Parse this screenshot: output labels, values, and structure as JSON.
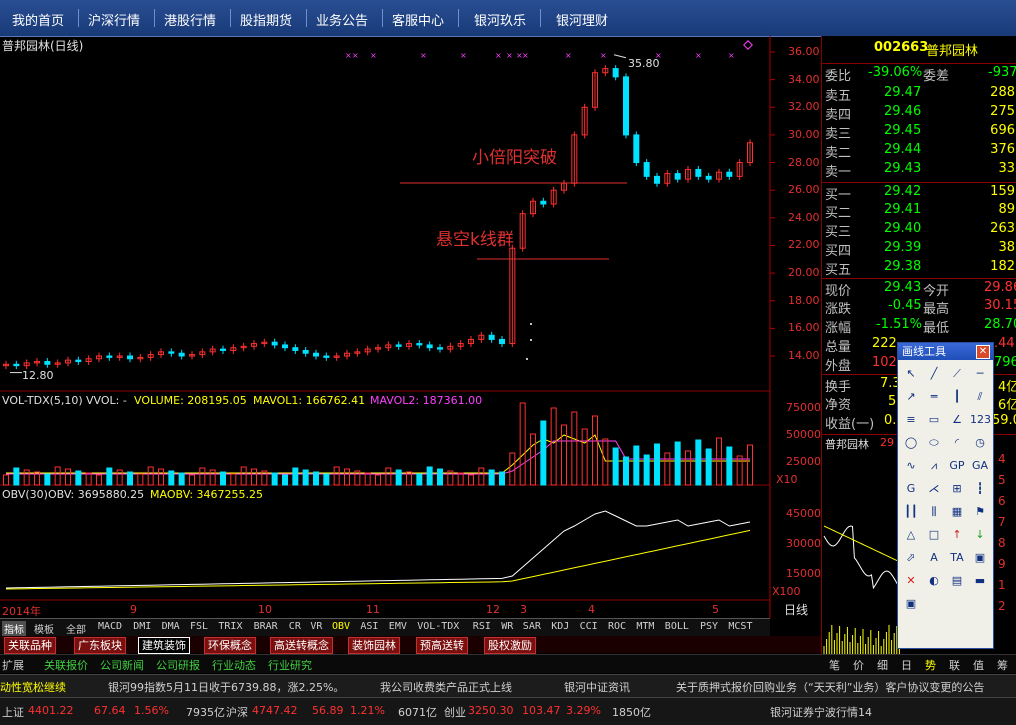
{
  "menu": [
    "我的首页",
    "沪深行情",
    "港股行情",
    "股指期货",
    "业务公告",
    "客服中心",
    "银河玖乐",
    "银河理财"
  ],
  "chart": {
    "title": "普邦园林(日线)",
    "price_ticks": [
      "36.00",
      "34.00",
      "32.00",
      "30.00",
      "28.00",
      "26.00",
      "24.00",
      "22.00",
      "20.00",
      "18.00",
      "16.00",
      "14.00"
    ],
    "high_label": "35.80",
    "low_label": "12.80",
    "annotation_top": "小倍阳突破",
    "annotation_bottom": "悬空k线群",
    "volume_header": {
      "name": "VOL-TDX(5,10)",
      "vvol": "VVOL: -",
      "volume": "VOLUME: 208195.05",
      "mavol1": "MAVOL1: 166762.41",
      "mavol2": "MAVOL2: 187361.00"
    },
    "volume_ticks": [
      "75000",
      "50000",
      "25000"
    ],
    "volume_unit": "X10",
    "obv_header": {
      "name": "OBV(30)",
      "obv": "OBV: 3695880.25",
      "maobv": "MAOBV: 3467255.25"
    },
    "obv_ticks": [
      "45000",
      "30000",
      "15000"
    ],
    "obv_unit": "X100",
    "period_label": "日线",
    "time_axis": [
      "2014年",
      "9",
      "10",
      "11",
      "12",
      "3",
      "4",
      "5"
    ]
  },
  "chart_data": {
    "type": "candlestick",
    "title": "普邦园林(日线)",
    "ylim": [
      12,
      37
    ],
    "high": 35.8,
    "low": 12.8,
    "close": [
      13.4,
      13.3,
      13.5,
      13.6,
      13.4,
      13.5,
      13.7,
      13.6,
      13.8,
      14.0,
      13.9,
      14.0,
      13.8,
      13.9,
      14.1,
      14.3,
      14.2,
      14.0,
      14.1,
      14.3,
      14.5,
      14.4,
      14.6,
      14.7,
      14.9,
      15.0,
      14.8,
      14.6,
      14.4,
      14.2,
      14.0,
      13.9,
      14.0,
      14.2,
      14.3,
      14.5,
      14.6,
      14.8,
      14.7,
      14.9,
      14.8,
      14.6,
      14.5,
      14.7,
      14.9,
      15.2,
      15.5,
      15.2,
      14.9,
      21.8,
      24.3,
      25.2,
      25.0,
      26.0,
      26.5,
      30.0,
      32.0,
      34.5,
      34.8,
      34.2,
      30.0,
      28.0,
      27.0,
      26.5,
      27.2,
      26.8,
      27.5,
      27.0,
      26.8,
      27.3,
      27.0,
      28.0,
      29.43
    ]
  },
  "quote": {
    "code": "002663",
    "name": "普邦园林",
    "weibi_label": "委比",
    "weibi": "-39.06%",
    "weicha_label": "委差",
    "weicha": "-937",
    "sells": [
      {
        "label": "卖五",
        "price": "29.47",
        "vol": "288"
      },
      {
        "label": "卖四",
        "price": "29.46",
        "vol": "275"
      },
      {
        "label": "卖三",
        "price": "29.45",
        "vol": "696"
      },
      {
        "label": "卖二",
        "price": "29.44",
        "vol": "376"
      },
      {
        "label": "卖一",
        "price": "29.43",
        "vol": "33"
      }
    ],
    "buys": [
      {
        "label": "买一",
        "price": "29.42",
        "vol": "159"
      },
      {
        "label": "买二",
        "price": "29.41",
        "vol": "89"
      },
      {
        "label": "买三",
        "price": "29.40",
        "vol": "263"
      },
      {
        "label": "买四",
        "price": "29.39",
        "vol": "38"
      },
      {
        "label": "买五",
        "price": "29.38",
        "vol": "182"
      }
    ],
    "xianjia_label": "现价",
    "xianjia": "29.43",
    "jinkai_label": "今开",
    "jinkai": "29.86",
    "zhangdie_label": "涨跌",
    "zhangdie": "-0.45",
    "zuigao_label": "最高",
    "zuigao": "30.15",
    "zhangfu_label": "涨幅",
    "zhangfu": "-1.51%",
    "zuidi_label": "最低",
    "zuidi": "28.70",
    "zongliang_label": "总量",
    "zongliang": "222",
    "zongliang_right": ".44",
    "waipan_label": "外盘",
    "waipan": "102",
    "waipan_right": "796",
    "huanshou_label": "换手",
    "huanshou": "7.3",
    "huanshou_right": "4亿",
    "jingzi_label": "净资",
    "jingzi": "5",
    "jingzi_right": "6亿",
    "shouyi_label": "收益(一)",
    "shouyi": "0.",
    "shouyi_right": "59.0",
    "mini_title": "普邦园林",
    "mini_num": "29"
  },
  "tool": {
    "title": "画线工具",
    "icons": [
      "cursor-icon",
      "line-icon",
      "ray-icon",
      "segment-icon",
      "arrow-line-icon",
      "hline-icon",
      "vline-icon",
      "channel-icon",
      "fib-icon",
      "rect-icon",
      "angle-icon",
      "text-icon",
      "circle-icon",
      "ellipse-icon",
      "arc-icon",
      "clock-icon",
      "wave-icon",
      "zigzag-icon",
      "gp-icon",
      "ga-icon",
      "g-icon",
      "fan-icon",
      "gann-icon",
      "period-icon",
      "bars-icon",
      "comb-icon",
      "grid-icon",
      "flag-icon",
      "triangle-icon",
      "square-icon",
      "up-arrow-icon",
      "down-arrow-icon",
      "trend-icon",
      "letter-a-icon",
      "text-a-icon",
      "box-icon",
      "delete-icon",
      "hide-icon",
      "doc-icon",
      "ruler-icon",
      "panel-icon"
    ],
    "labels": {
      "gp": "GP",
      "ga": "GA",
      "g": "G",
      "a": "A",
      "ta": "TA",
      "num": "123"
    }
  },
  "right_edge_nums": [
    "4",
    "5",
    "6",
    "7",
    "8",
    "9",
    "1",
    "2"
  ],
  "tabs1": [
    "指标",
    "模板",
    "全部",
    "MACD",
    "DMI",
    "DMA",
    "FSL",
    "TRIX",
    "BRAR",
    "CR",
    "VR",
    "OBV",
    "ASI",
    "EMV",
    "VOL-TDX",
    "RSI",
    "WR",
    "SAR",
    "KDJ",
    "CCI",
    "ROC",
    "MTM",
    "BOLL",
    "PSY",
    "MCST"
  ],
  "tabs2": [
    "关联品种",
    "广东板块",
    "建筑装饰",
    "环保概念",
    "高送转概念",
    "装饰园林",
    "预高送转",
    "股权激励"
  ],
  "tabs3": [
    "扩展",
    "关联报价",
    "公司新闻",
    "公司研报",
    "行业动态",
    "行业研究"
  ],
  "tabs4": [
    "笔",
    "价",
    "细",
    "日",
    "势",
    "联",
    "值",
    "筹"
  ],
  "news": [
    "动性宽松继续",
    "银河99指数5月11日收于6739.88，涨2.25%。",
    "我公司收费类产品正式上线",
    "银河中证资讯",
    "关于质押式报价回购业务（“天天利”业务）客户协议变更的公告"
  ],
  "status": {
    "sh_label": "上证",
    "sh": "4401.22",
    "sh_chg": "67.64",
    "sh_pct": "1.56%",
    "sh_amt": "7935亿",
    "hs_label": "沪深",
    "hs": "4747.42",
    "hs_chg": "56.89",
    "hs_pct": "1.21%",
    "hs_amt": "6071亿",
    "cy_label": "创业",
    "cy": "3250.30",
    "cy_chg": "103.47",
    "cy_pct": "3.29%",
    "cy_amt": "1850亿",
    "right": "银河证券宁波行情14"
  },
  "colors": {
    "up": "#ff3030",
    "down": "#00e0ff",
    "menu_bg": "#1f4587",
    "grid": "#8a0000",
    "yellow": "#ffff00",
    "magenta": "#ff40ff"
  }
}
